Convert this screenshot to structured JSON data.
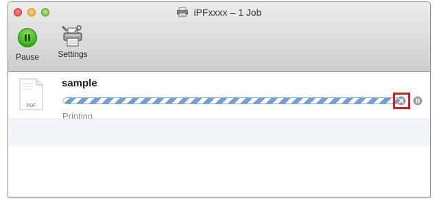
{
  "window": {
    "title": "iPFxxxx – 1 Job"
  },
  "toolbar": {
    "pause_label": "Pause",
    "settings_label": "Settings"
  },
  "jobs": [
    {
      "name": "sample",
      "file_type": "PDF",
      "status": "Printing",
      "progress_percent": 100
    }
  ],
  "colors": {
    "progress_stripe": "#6f9fe0",
    "highlight_box": "#e01818",
    "pause_button": "#44b61d"
  },
  "icons": {
    "window_title": "printer-icon",
    "pause": "pause-icon",
    "settings": "printer-settings-icon",
    "document": "pdf-document-icon",
    "stop": "stop-circle-icon",
    "hold": "hold-circle-icon"
  }
}
